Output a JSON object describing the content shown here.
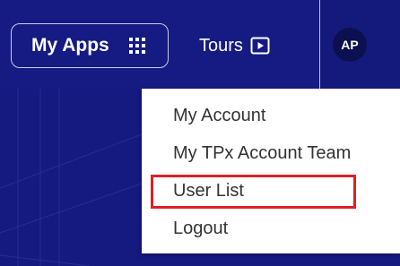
{
  "header": {
    "my_apps_label": "My Apps",
    "my_apps_icon": "grid-icon",
    "tours_label": "Tours",
    "tours_icon": "play-icon",
    "avatar_initials": "AP"
  },
  "user_menu": {
    "items": [
      {
        "label": "My Account"
      },
      {
        "label": "My TPx Account Team"
      },
      {
        "label": "User List",
        "highlighted": true
      },
      {
        "label": "Logout"
      }
    ]
  },
  "colors": {
    "header_bg": "#151b82",
    "highlight_border": "#e01e26",
    "menu_text": "#333333"
  }
}
